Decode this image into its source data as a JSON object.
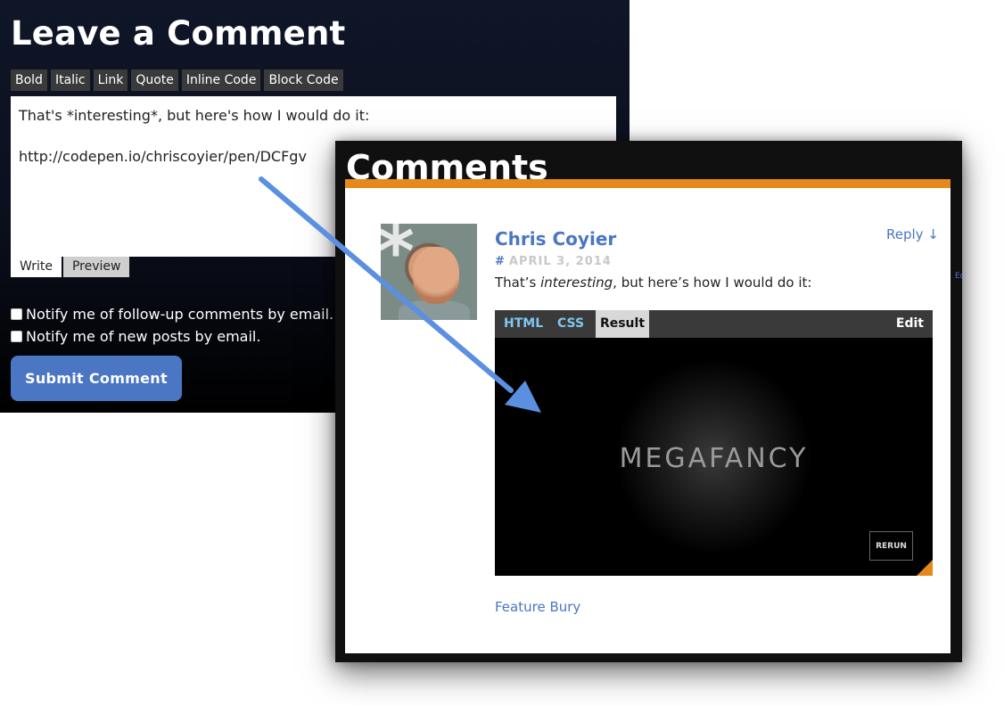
{
  "leave_comment": {
    "title": "Leave a Comment",
    "toolbar": [
      "Bold",
      "Italic",
      "Link",
      "Quote",
      "Inline Code",
      "Block Code"
    ],
    "textarea_lines": [
      "That's *interesting*, but here's how I would do it:",
      "",
      "http://codepen.io/chriscoyier/pen/DCFgv"
    ],
    "mode_tabs": {
      "write": "Write",
      "preview": "Preview"
    },
    "notify_followup": "Notify me of follow-up comments by email.",
    "notify_posts": "Notify me of new posts by email.",
    "submit_label": "Submit Comment"
  },
  "comments": {
    "title": "Comments",
    "accent_color": "#e58a1a",
    "link_color": "#4a76c4",
    "comment": {
      "author": "Chris Coyier",
      "reply_label": "Reply ↓",
      "date_hash": "#",
      "date": "APRIL 3, 2014",
      "text_before": "That’s ",
      "text_em": "interesting",
      "text_after": ", but here’s how I would do it:",
      "side_edit": "Ed",
      "feature_label": "Feature Bury"
    },
    "pen": {
      "tabs": {
        "html": "HTML",
        "css": "CSS",
        "result": "Result",
        "edit": "Edit"
      },
      "result_text": "MEGAFANCY",
      "rerun_label": "RERUN"
    }
  }
}
